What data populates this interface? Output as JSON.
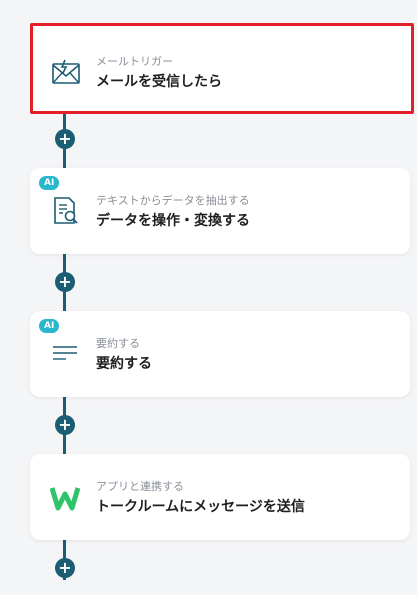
{
  "steps": [
    {
      "subtitle": "メールトリガー",
      "title": "メールを受信したら",
      "icon": "mail-trigger-icon",
      "selected": true
    },
    {
      "subtitle": "テキストからデータを抽出する",
      "title": "データを操作・変換する",
      "icon": "document-search-icon",
      "badge": "AI"
    },
    {
      "subtitle": "要約する",
      "title": "要約する",
      "icon": "summarize-lines-icon",
      "badge": "AI"
    },
    {
      "subtitle": "アプリと連携する",
      "title": "トークルームにメッセージを送信",
      "icon": "w-logo-icon"
    }
  ],
  "add_button_symbol": "+",
  "colors": {
    "connector": "#1b5d72",
    "selected_border": "#e3202a",
    "ai_badge": "#28b7cb"
  }
}
